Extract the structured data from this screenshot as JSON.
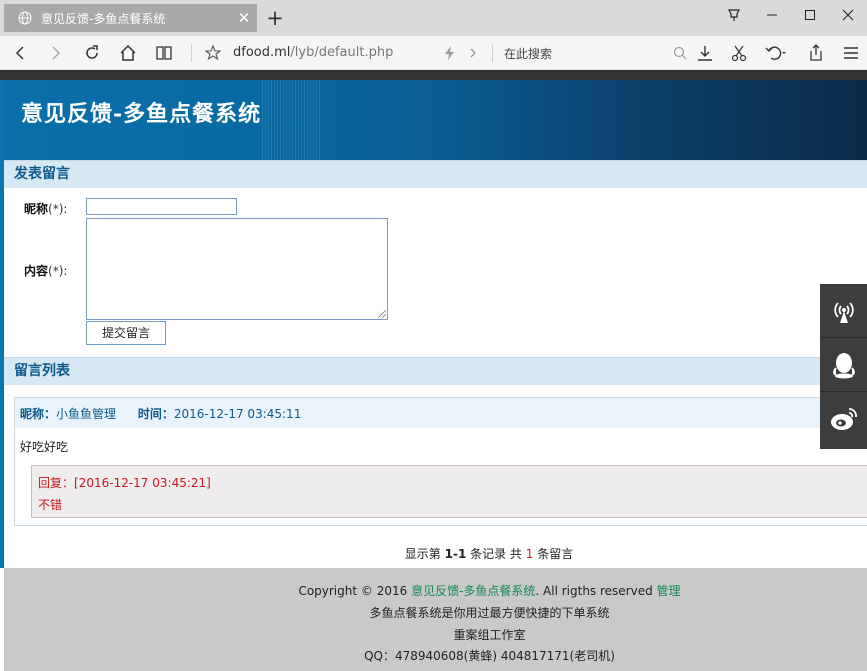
{
  "browser": {
    "tab_title": "意见反馈-多鱼点餐系统",
    "url_host": "dfood.ml",
    "url_path": "/lyb/default.php",
    "search_placeholder": "在此搜索"
  },
  "site": {
    "title": "意见反馈-多鱼点餐系统"
  },
  "form": {
    "section_title": "发表留言",
    "nickname_label": "昵称",
    "content_label": "内容",
    "required_mark": "(*):",
    "nickname_value": "",
    "content_value": "",
    "submit_label": "提交留言"
  },
  "list": {
    "section_title": "留言列表",
    "messages": [
      {
        "nick_label": "昵称：",
        "nick": "小鱼鱼管理",
        "time_label": "时间：",
        "time": "2016-12-17 03:45:11",
        "body": "好吃好吃",
        "reply_label": "回复：",
        "reply_time": "[2016-12-17 03:45:21]",
        "reply_text": "不错"
      }
    ]
  },
  "pager": {
    "prefix": "显示第 ",
    "range": "1-1",
    "mid": " 条记录  共 ",
    "total": "1",
    "suffix": " 条留言"
  },
  "footer": {
    "copyright_prefix": "Copyright © 2016 ",
    "site_link": "意见反馈-多鱼点餐系统",
    "rights": ". All rigths reserved ",
    "admin_link": "管理",
    "line2": "多鱼点餐系统是你用过最方便快捷的下单系统",
    "line3": "重案组工作室",
    "line4": "QQ：478940608(黄蜂) 404817171(老司机)"
  },
  "float_icons": [
    "broadcast-icon",
    "qq-icon",
    "weibo-icon"
  ]
}
